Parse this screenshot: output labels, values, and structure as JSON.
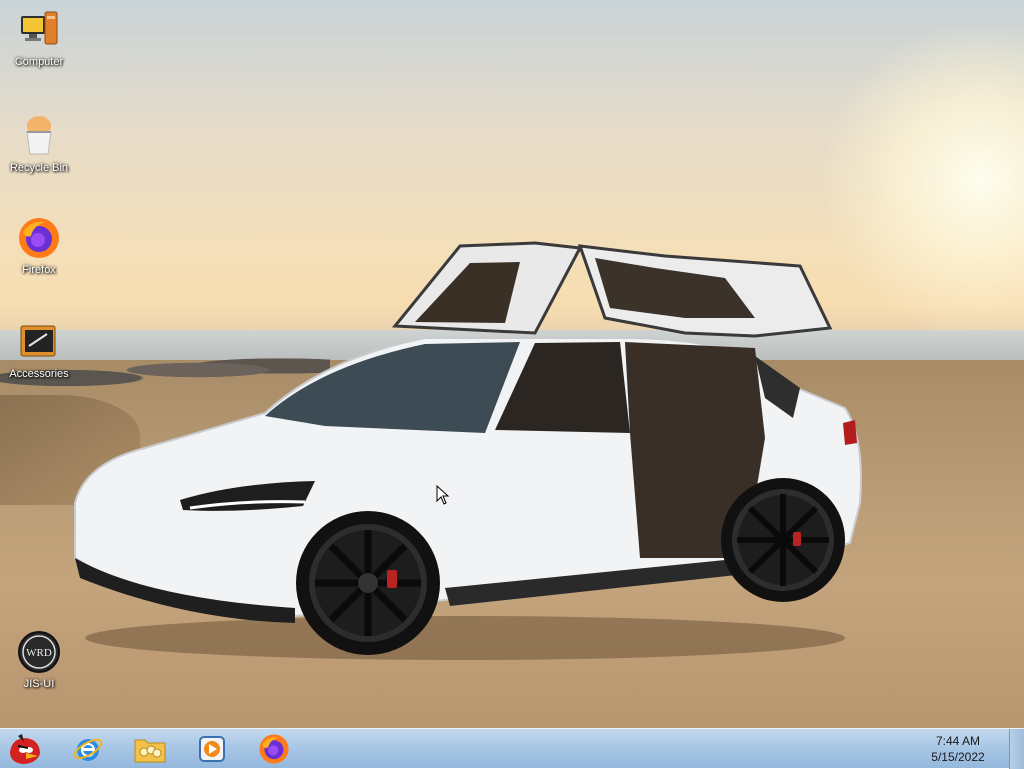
{
  "desktop": {
    "icons": [
      {
        "label": "Computer",
        "icon": "computer-icon"
      },
      {
        "label": "Recycle Bin",
        "icon": "recycle-bin-icon"
      },
      {
        "label": "Firefox",
        "icon": "firefox-icon"
      },
      {
        "label": "Accessories",
        "icon": "accessories-icon"
      },
      {
        "label": "JIS-UI",
        "icon": "wrd-app-icon"
      }
    ],
    "wrd_logo_text": "WRD"
  },
  "taskbar": {
    "pinned": [
      {
        "name": "angry-birds-icon"
      },
      {
        "name": "internet-explorer-icon"
      },
      {
        "name": "file-explorer-icon"
      },
      {
        "name": "media-player-icon"
      },
      {
        "name": "firefox-icon"
      }
    ],
    "clock": {
      "time": "7:44 AM",
      "date": "5/15/2022"
    }
  },
  "colors": {
    "taskbar_top": "#c3d9ee",
    "taskbar_bottom": "#94b8dc",
    "accent_firefox": "#ff6a1a"
  }
}
